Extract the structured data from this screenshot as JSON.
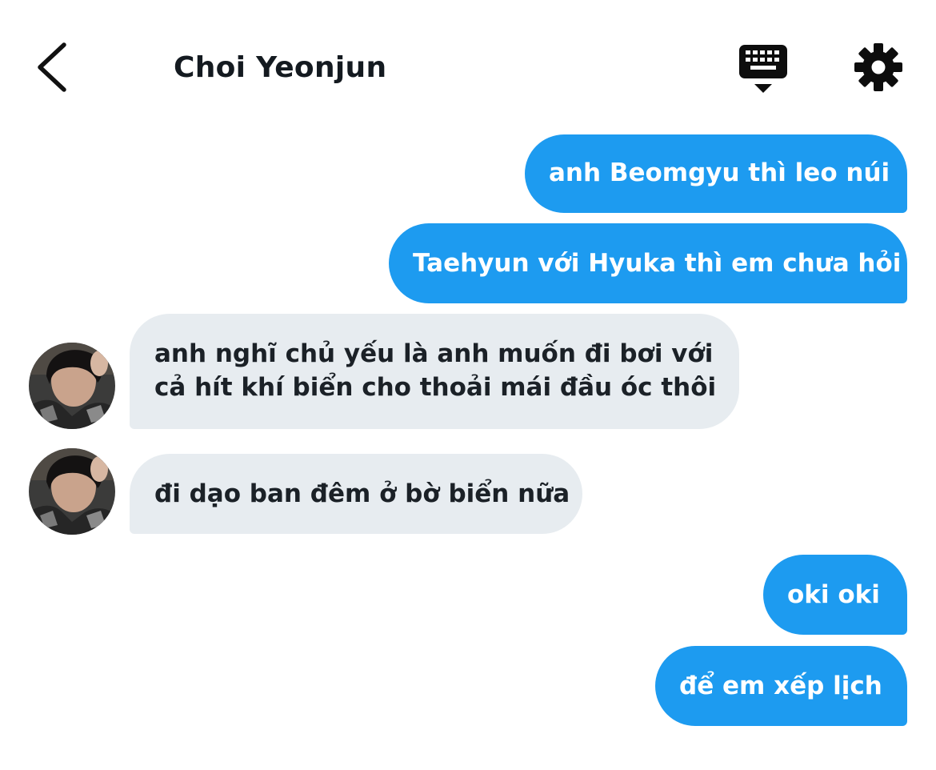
{
  "header": {
    "back_icon": "chevron-left-icon",
    "title": "Choi Yeonjun",
    "keyboard_icon": "keyboard-icon",
    "settings_icon": "gear-icon"
  },
  "colors": {
    "outgoing_bubble": "#1d9bf0",
    "incoming_bubble": "#e7ecf0",
    "title_text": "#141a20"
  },
  "messages": [
    {
      "direction": "outgoing",
      "text": "anh Beomgyu thì leo núi"
    },
    {
      "direction": "outgoing",
      "text": "Taehyun với Hyuka thì em chưa hỏi"
    },
    {
      "direction": "incoming",
      "lines": [
        "anh nghĩ chủ yếu là anh muốn đi bơi với",
        "cả hít khí biển cho thoải mái đầu óc thôi"
      ]
    },
    {
      "direction": "incoming",
      "text": "đi dạo ban đêm ở bờ biển nữa"
    },
    {
      "direction": "outgoing",
      "text": "oki oki"
    },
    {
      "direction": "outgoing",
      "text": "để em xếp lịch"
    }
  ]
}
